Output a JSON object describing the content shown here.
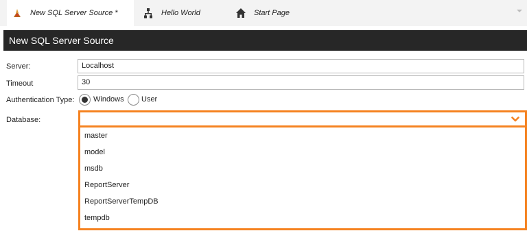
{
  "tabs": [
    {
      "label": "New SQL Server Source *",
      "icon": "sql-server-source-icon",
      "active": true
    },
    {
      "label": "Hello World",
      "icon": "workflow-icon",
      "active": false
    },
    {
      "label": "Start Page",
      "icon": "home-icon",
      "active": false
    }
  ],
  "header": {
    "title": "New SQL Server Source"
  },
  "form": {
    "server": {
      "label": "Server:",
      "value": "Localhost"
    },
    "timeout": {
      "label": "Timeout",
      "value": "30"
    },
    "auth": {
      "label": "Authentication Type:",
      "options": [
        "Windows",
        "User"
      ],
      "selected": "Windows"
    },
    "database": {
      "label": "Database:",
      "value": "",
      "options": [
        "master",
        "model",
        "msdb",
        "ReportServer",
        "ReportServerTempDB",
        "tempdb"
      ]
    }
  },
  "colors": {
    "accent": "#f58220",
    "header_bg": "#272727",
    "tabbar_bg": "#f3f3f3"
  }
}
